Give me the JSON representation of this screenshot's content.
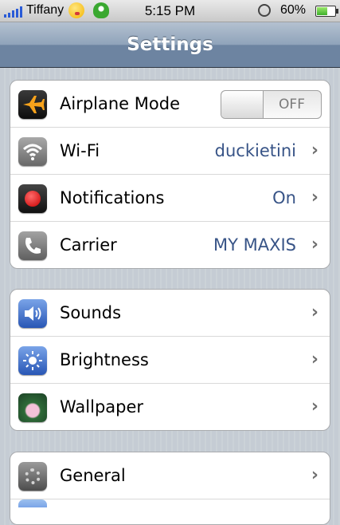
{
  "status_bar": {
    "carrier": "Tiffany",
    "time": "5:15 PM",
    "battery_percent": "60%",
    "battery_level": 0.6,
    "icons": [
      "signal-bars-icon",
      "emoji-face-icon",
      "mushroom-icon",
      "rotation-lock-icon",
      "battery-icon"
    ]
  },
  "nav": {
    "title": "Settings"
  },
  "group1": {
    "airplane": {
      "label": "Airplane Mode",
      "toggle": "OFF",
      "icon": "airplane-icon"
    },
    "wifi": {
      "label": "Wi-Fi",
      "value": "duckietini",
      "icon": "wifi-icon"
    },
    "notifications": {
      "label": "Notifications",
      "value": "On",
      "icon": "notifications-icon"
    },
    "carrier": {
      "label": "Carrier",
      "value": "MY MAXIS",
      "icon": "phone-icon"
    }
  },
  "group2": {
    "sounds": {
      "label": "Sounds",
      "icon": "speaker-icon"
    },
    "brightness": {
      "label": "Brightness",
      "icon": "sun-icon"
    },
    "wallpaper": {
      "label": "Wallpaper",
      "icon": "flower-icon"
    }
  },
  "group3": {
    "general": {
      "label": "General",
      "icon": "gear-icon"
    }
  },
  "chevron": "›",
  "colors": {
    "value_text": "#385487",
    "nav_bar": "#6d84a1",
    "signal": "#2a5bd7"
  }
}
